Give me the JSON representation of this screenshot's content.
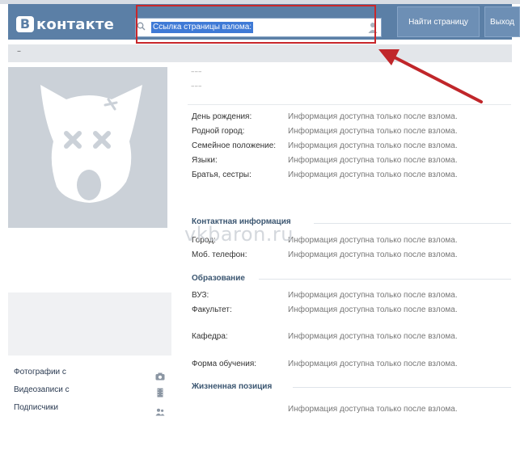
{
  "header": {
    "logo_letter": "В",
    "logo_text": "контакте",
    "search_value": "Ссылка страницы взлома:",
    "find_button": "Найти страницу",
    "exit_button": "Выход"
  },
  "subbar": {
    "text": "–"
  },
  "profile": {
    "name_placeholder": "–––",
    "status_placeholder": "–––",
    "info": [
      {
        "label": "День рождения:",
        "value": "Информация доступна только после взлома."
      },
      {
        "label": "Родной город:",
        "value": "Информация доступна только после взлома."
      },
      {
        "label": "Семейное положение:",
        "value": "Информация доступна только после взлома."
      },
      {
        "label": "Языки:",
        "value": "Информация доступна только после взлома."
      },
      {
        "label": "Братья, сестры:",
        "value": "Информация доступна только после взлома."
      }
    ],
    "contact": {
      "title": "Контактная информация",
      "rows": [
        {
          "label": "Город:",
          "value": "Информация доступна только после взлома."
        },
        {
          "label": "Моб. телефон:",
          "value": "Информация доступна только после взлома."
        }
      ]
    },
    "education": {
      "title": "Образование",
      "rows": [
        {
          "label": "ВУЗ:",
          "value": "Информация доступна только после взлома."
        },
        {
          "label": "Факультет:",
          "value": "Информация доступна только после взлома."
        },
        {
          "label": "Кафедра:",
          "value": "Информация доступна только после взлома."
        },
        {
          "label": "Форма обучения:",
          "value": "Информация доступна только после взлома."
        }
      ]
    },
    "life": {
      "title": "Жизненная позиция",
      "value": "Информация доступна только после взлома."
    }
  },
  "sidebar": {
    "links": [
      "Фотографии с",
      "Видеозаписи с",
      "Подписчики"
    ]
  },
  "watermark": "vkbaron.ru",
  "colors": {
    "header": "#5b7fa6",
    "highlight_frame": "#c8272b",
    "arrow": "#c0262a"
  },
  "icons": [
    "search-icon",
    "user-icon",
    "camera-icon",
    "film-icon",
    "people-icon",
    "dog-avatar-icon"
  ]
}
